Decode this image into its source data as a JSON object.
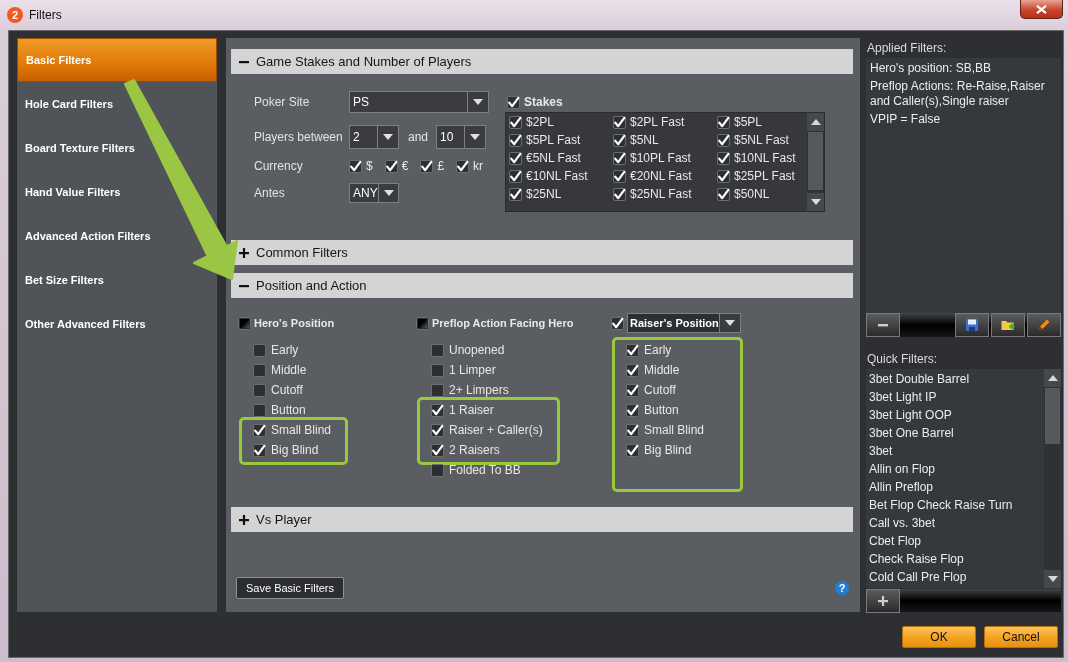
{
  "window": {
    "logo": "2",
    "title": "Filters"
  },
  "sidebar": {
    "items": [
      {
        "label": "Basic Filters",
        "selected": true
      },
      {
        "label": "Hole Card Filters",
        "selected": false
      },
      {
        "label": "Board Texture Filters",
        "selected": false
      },
      {
        "label": "Hand Value Filters",
        "selected": false
      },
      {
        "label": "Advanced Action Filters",
        "selected": false
      },
      {
        "label": "Bet Size Filters",
        "selected": false
      },
      {
        "label": "Other Advanced Filters",
        "selected": false
      }
    ]
  },
  "sections": [
    {
      "kind": "stakes",
      "title": "Game Stakes and Number of Players",
      "expanded": true,
      "poker_site": {
        "label": "Poker Site",
        "value": "PS"
      },
      "players": {
        "label": "Players between",
        "min": "2",
        "joiner": "and",
        "max": "10"
      },
      "currency": {
        "label": "Currency",
        "options": [
          {
            "label": "$",
            "checked": true
          },
          {
            "label": "€",
            "checked": true
          },
          {
            "label": "£",
            "checked": true
          },
          {
            "label": "kr",
            "checked": true
          }
        ]
      },
      "antes": {
        "label": "Antes",
        "value": "ANY"
      },
      "stakes": {
        "label": "Stakes",
        "checked": true,
        "items": [
          {
            "label": "$2PL",
            "checked": true
          },
          {
            "label": "$2PL Fast",
            "checked": true
          },
          {
            "label": "$5PL",
            "checked": true
          },
          {
            "label": "$5PL Fast",
            "checked": true
          },
          {
            "label": "$5NL",
            "checked": true
          },
          {
            "label": "$5NL Fast",
            "checked": true
          },
          {
            "label": "€5NL Fast",
            "checked": true
          },
          {
            "label": "$10PL Fast",
            "checked": true
          },
          {
            "label": "$10NL Fast",
            "checked": true
          },
          {
            "label": "€10NL Fast",
            "checked": true
          },
          {
            "label": "€20NL Fast",
            "checked": true
          },
          {
            "label": "$25PL Fast",
            "checked": true
          },
          {
            "label": "$25NL",
            "checked": true
          },
          {
            "label": "$25NL Fast",
            "checked": true
          },
          {
            "label": "$50NL",
            "checked": true
          }
        ]
      }
    },
    {
      "title": "Common Filters",
      "expanded": false
    },
    {
      "kind": "position",
      "title": "Position and Action",
      "expanded": true,
      "groups": [
        {
          "kind": "label",
          "title": "Hero's Position",
          "checked": false,
          "mixed": true,
          "items": [
            {
              "kind": "option",
              "label": "Early",
              "checked": false
            },
            {
              "kind": "option",
              "label": "Middle",
              "checked": false
            },
            {
              "kind": "option",
              "label": "Cutoff",
              "checked": false
            },
            {
              "kind": "option",
              "label": "Button",
              "checked": false
            },
            {
              "kind": "highlight",
              "items": [
                {
                  "kind": "option",
                  "label": "Small Blind",
                  "checked": true
                },
                {
                  "kind": "option",
                  "label": "Big Blind",
                  "checked": true
                }
              ]
            }
          ]
        },
        {
          "kind": "label",
          "title": "Preflop Action Facing Hero",
          "checked": false,
          "mixed": true,
          "items": [
            {
              "kind": "option",
              "label": "Unopened",
              "checked": false
            },
            {
              "kind": "option",
              "label": "1 Limper",
              "checked": false
            },
            {
              "kind": "option",
              "label": "2+ Limpers",
              "checked": false
            },
            {
              "kind": "highlight",
              "items": [
                {
                  "kind": "option",
                  "label": "1 Raiser",
                  "checked": true
                },
                {
                  "kind": "option",
                  "label": "Raiser + Caller(s)",
                  "checked": true
                },
                {
                  "kind": "option",
                  "label": "2 Raisers",
                  "checked": true
                }
              ]
            },
            {
              "kind": "option",
              "label": "Folded To BB",
              "checked": false
            }
          ]
        },
        {
          "kind": "dropdown",
          "title": "Raiser's Position",
          "checked": true,
          "items": [
            {
              "kind": "highlight",
              "items": [
                {
                  "kind": "option",
                  "label": "Early",
                  "checked": true
                },
                {
                  "kind": "option",
                  "label": "Middle",
                  "checked": true
                },
                {
                  "kind": "option",
                  "label": "Cutoff",
                  "checked": true
                },
                {
                  "kind": "option",
                  "label": "Button",
                  "checked": true
                },
                {
                  "kind": "option",
                  "label": "Small Blind",
                  "checked": true
                },
                {
                  "kind": "option",
                  "label": "Big Blind",
                  "checked": true
                }
              ]
            }
          ]
        }
      ]
    },
    {
      "title": "Vs Player",
      "expanded": false
    }
  ],
  "save_button": "Save Basic Filters",
  "help": "?",
  "applied_filters": {
    "title": "Applied Filters:",
    "lines": [
      "Hero's position: SB,BB",
      "Preflop Actions: Re-Raise,Raiser and Caller(s),Single raiser",
      "VPIP = False"
    ]
  },
  "quick_filters": {
    "title": "Quick Filters:",
    "items": [
      "3bet Double Barrel",
      "3bet Light IP",
      "3bet Light OOP",
      "3bet One Barrel",
      "3bet",
      "Allin on Flop",
      "Allin Preflop",
      "Bet Flop Check Raise Turn",
      "Call vs. 3bet",
      "Cbet Flop",
      "Check Raise Flop",
      "Cold Call Pre Flop"
    ]
  },
  "buttons": [
    "OK",
    "Cancel"
  ],
  "annotation_arrow": true
}
